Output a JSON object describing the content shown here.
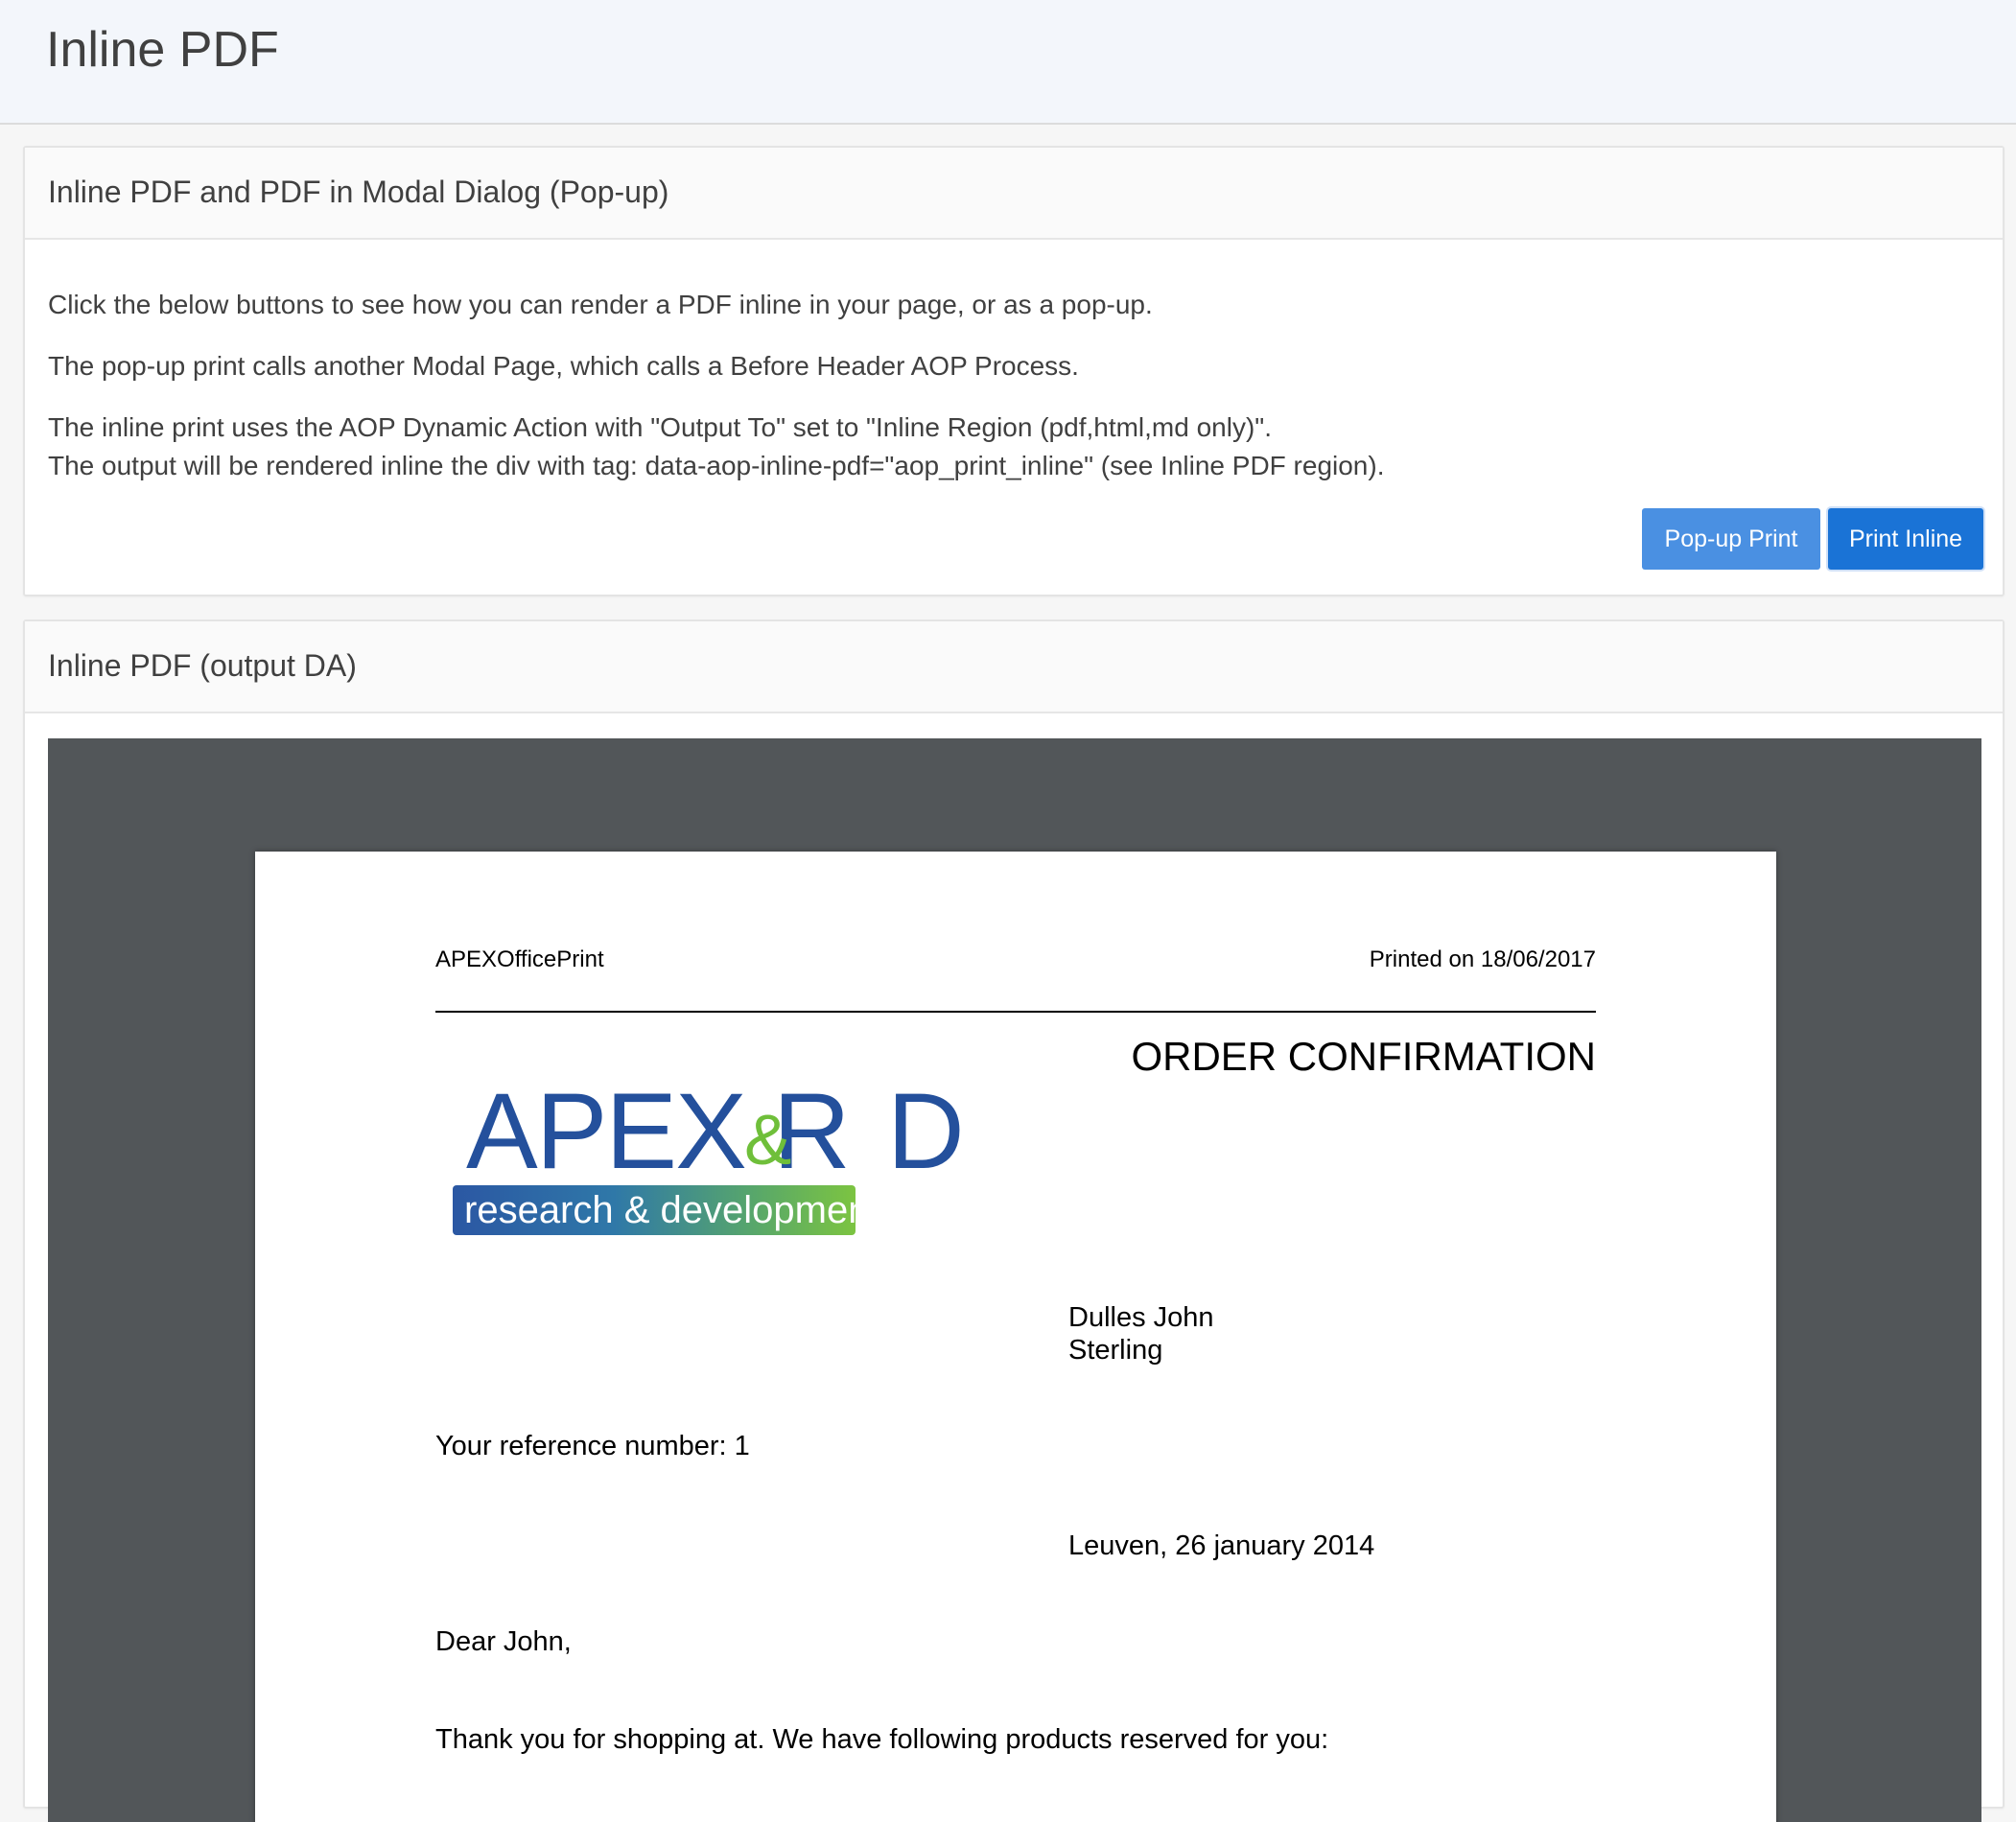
{
  "page": {
    "title": "Inline PDF"
  },
  "region_modal": {
    "title": "Inline PDF and PDF in Modal Dialog (Pop-up)",
    "paragraphs": [
      "Click the below buttons to see how you can render a PDF inline in your page, or as a pop-up.",
      "The pop-up print calls another Modal Page, which calls a Before Header AOP Process.",
      "The inline print uses the AOP Dynamic Action with \"Output To\" set to \"Inline Region (pdf,html,md only)\".",
      "The output will be rendered inline the div with tag: data-aop-inline-pdf=\"aop_print_inline\" (see Inline PDF region)."
    ],
    "buttons": {
      "popup_label": "Pop-up Print",
      "inline_label": "Print Inline"
    },
    "colors": {
      "popup_button": "#4a90e2",
      "inline_button": "#1a73d6"
    }
  },
  "region_inline": {
    "title": "Inline PDF (output DA)"
  },
  "pdf": {
    "header_left": "APEXOfficePrint",
    "header_right": "Printed on 18/06/2017",
    "heading": "ORDER CONFIRMATION",
    "logo": {
      "main_text": "APEX R",
      "amp": "&",
      "main_text_end": "D",
      "sub_text": "research & development",
      "colors": {
        "blue": "#24509c",
        "green": "#6fbf3a"
      }
    },
    "address_name": "Dulles John",
    "address_city": "Sterling",
    "reference": "Your reference number: 1",
    "place_date": "Leuven, 26 january 2014",
    "salutation": "Dear John,",
    "body_line": "Thank you for shopping at. We have following products reserved for you:"
  }
}
